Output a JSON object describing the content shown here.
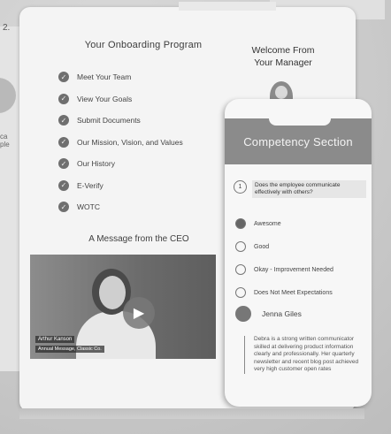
{
  "left_panel": {
    "number": "2.",
    "text": "ca\nple"
  },
  "onboarding": {
    "title": "Your Onboarding Program",
    "items": [
      "Meet Your Team",
      "View Your Goals",
      "Submit Documents",
      "Our Mission, Vision, and Values",
      "Our History",
      "E-Verify",
      "WOTC"
    ]
  },
  "ceo": {
    "title": "A Message from the CEO",
    "video_caption_name": "Arthur Kanson",
    "video_caption_sub": "Annual Message, Classic Co."
  },
  "manager": {
    "title": "Welcome From Your Manager"
  },
  "competency": {
    "header": "Competency Section",
    "question_number": "1",
    "question": "Does the employee communicate effectively with others?",
    "options": [
      {
        "label": "Awesome",
        "selected": true
      },
      {
        "label": "Good",
        "selected": false
      },
      {
        "label": "Okay - Improvement Needed",
        "selected": false
      },
      {
        "label": "Does Not Meet Expectations",
        "selected": false
      }
    ],
    "reviewer_name": "Jenna Giles",
    "comment": "Debra is a strong written communicator skilled at delivering product information clearly and professionally. Her quarterly newsletter and recent blog post achieved very high customer open rates"
  }
}
